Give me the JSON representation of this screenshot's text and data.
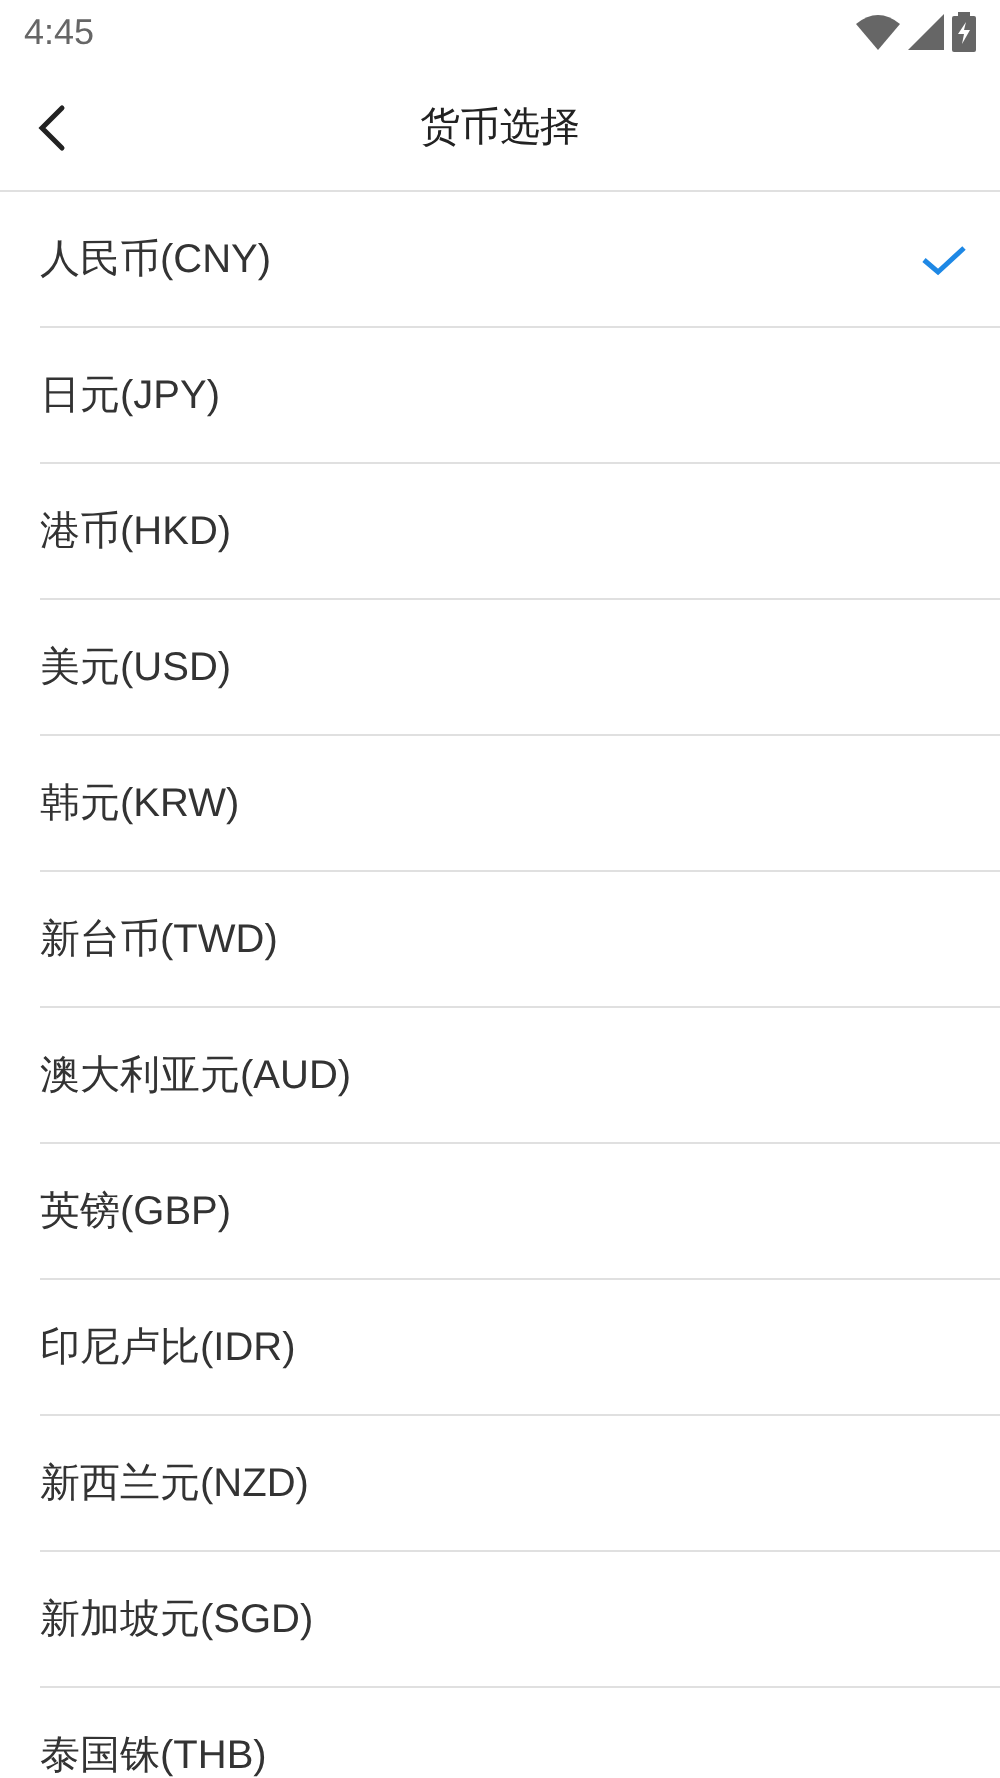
{
  "status_bar": {
    "time": "4:45"
  },
  "header": {
    "title": "货币选择"
  },
  "currencies": [
    {
      "label": "人民币(CNY)",
      "selected": true
    },
    {
      "label": "日元(JPY)",
      "selected": false
    },
    {
      "label": "港币(HKD)",
      "selected": false
    },
    {
      "label": "美元(USD)",
      "selected": false
    },
    {
      "label": "韩元(KRW)",
      "selected": false
    },
    {
      "label": "新台币(TWD)",
      "selected": false
    },
    {
      "label": "澳大利亚元(AUD)",
      "selected": false
    },
    {
      "label": "英镑(GBP)",
      "selected": false
    },
    {
      "label": "印尼卢比(IDR)",
      "selected": false
    },
    {
      "label": "新西兰元(NZD)",
      "selected": false
    },
    {
      "label": "新加坡元(SGD)",
      "selected": false
    },
    {
      "label": "泰国铢(THB)",
      "selected": false
    }
  ]
}
